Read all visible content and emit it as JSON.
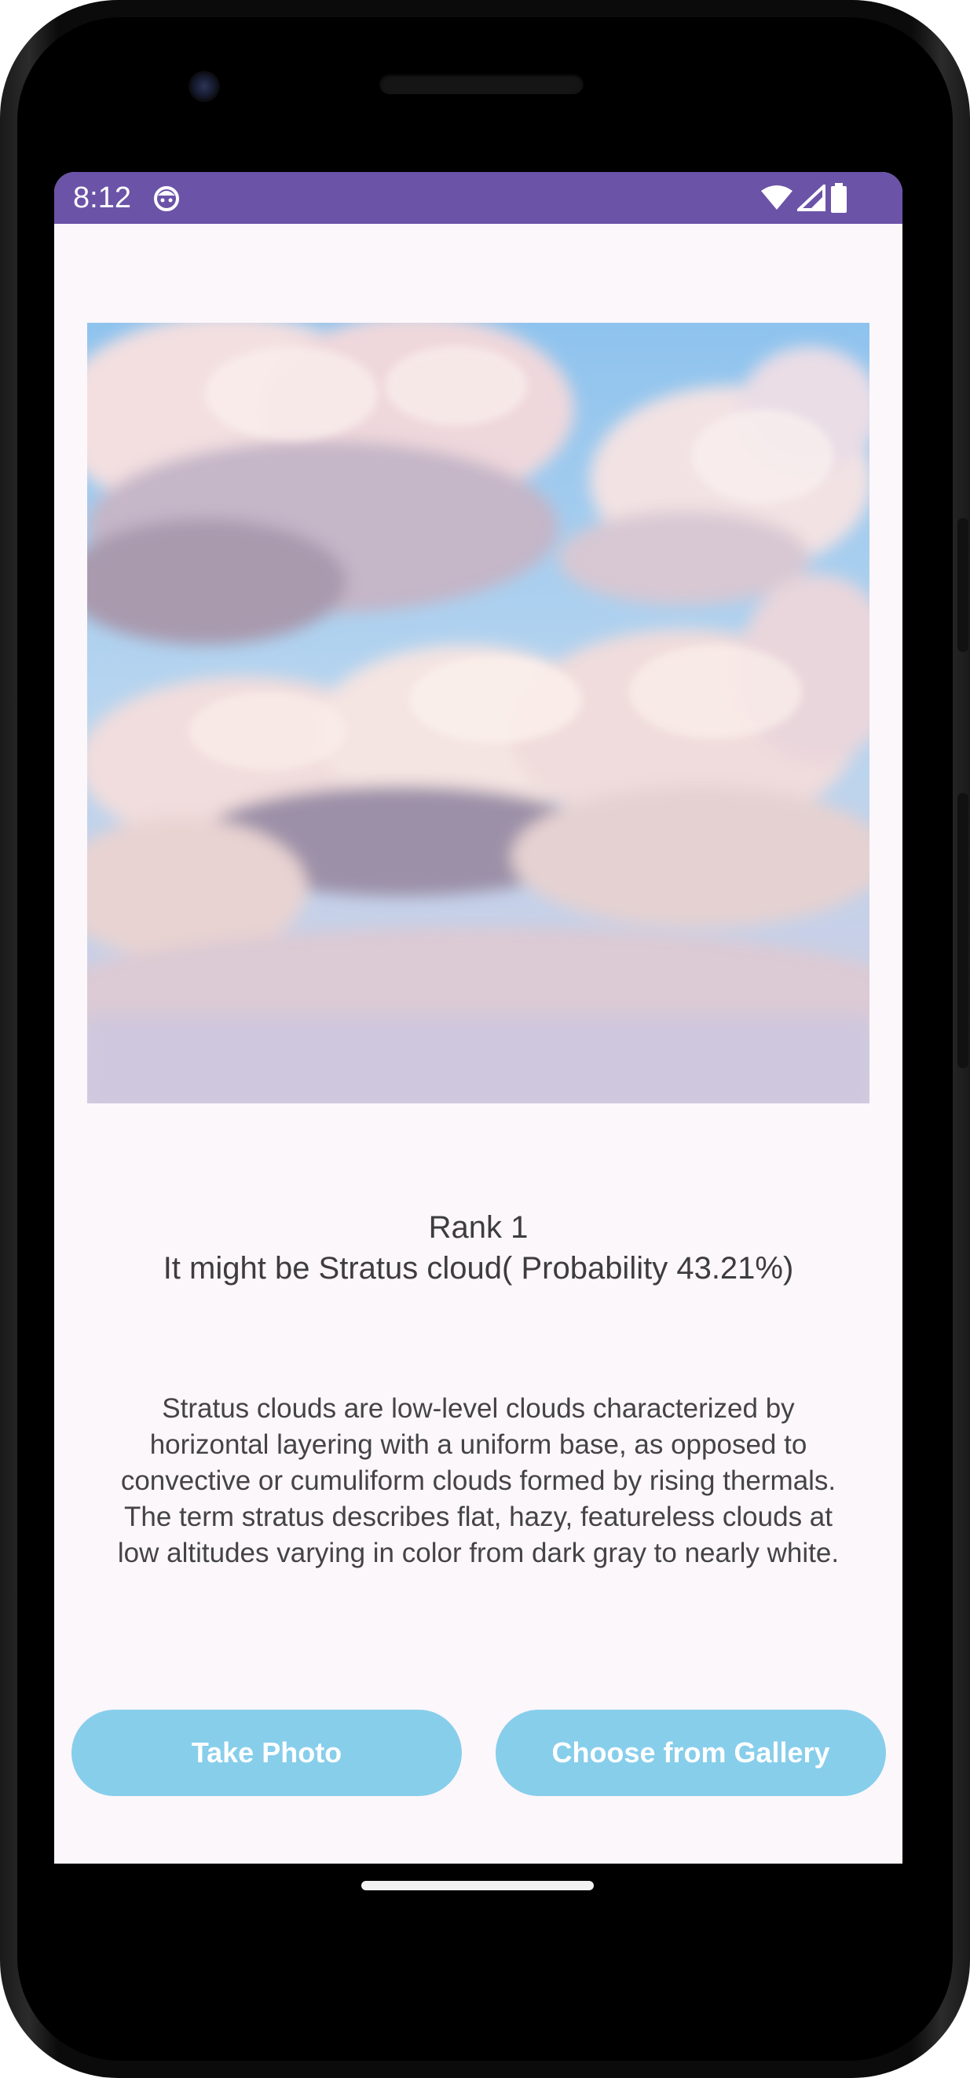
{
  "status_bar": {
    "time": "8:12",
    "icons": [
      "app-notification-icon",
      "wifi-icon",
      "cell-signal-icon",
      "battery-icon"
    ],
    "background": "#6b53a8"
  },
  "image": {
    "subject": "cloud photo"
  },
  "result": {
    "rank_label": "Rank 1",
    "prediction_text": "It might be Stratus cloud( Probability  43.21%)"
  },
  "description": {
    "lines": [
      "Stratus clouds are low-level clouds characterized by",
      "horizontal layering with a uniform base, as opposed to",
      "convective or cumuliform clouds formed by rising thermals.",
      "The term stratus describes flat, hazy, featureless clouds at",
      "low altitudes varying in color from dark gray to nearly white."
    ]
  },
  "buttons": {
    "take_photo": "Take Photo",
    "choose_gallery": "Choose from Gallery",
    "color": "#87ceeb"
  }
}
